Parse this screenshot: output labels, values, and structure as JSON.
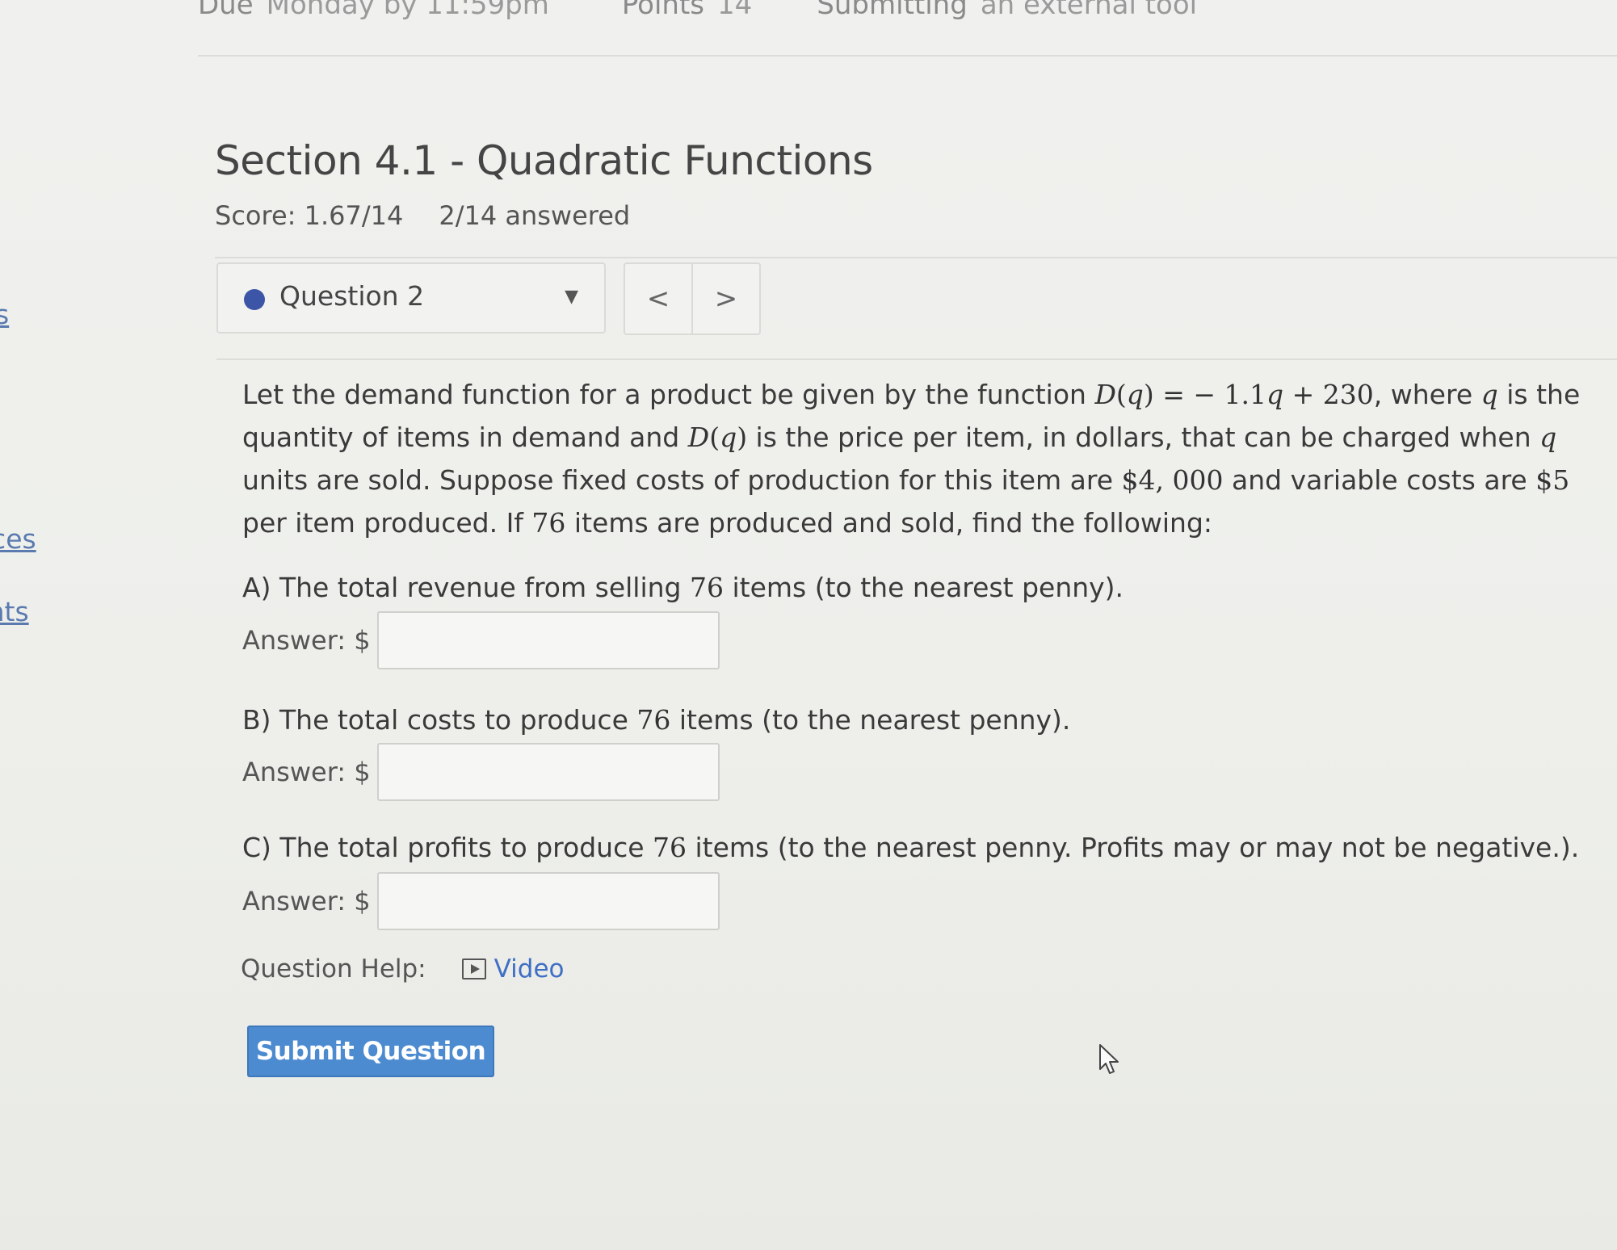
{
  "assignment": {
    "due_label": "Due",
    "due_value": "Monday by 11:59pm",
    "points_label": "Points",
    "points_value": "14",
    "submitting_label": "Submitting",
    "submitting_value": "an external tool"
  },
  "left_nav": {
    "item1": "s",
    "item2": "urces",
    "item3": "ents"
  },
  "section": {
    "title": "Section 4.1 - Quadratic Functions",
    "score": "Score: 1.67/14",
    "answered": "2/14 answered"
  },
  "question_selector": {
    "label": "Question 2",
    "prev": "<",
    "next": ">"
  },
  "question": {
    "intro_1": "Let the demand function for a product be given by the function ",
    "fn_D": "D",
    "fn_q": "q",
    "equation_rhs": " = − 1.1",
    "equation_q2": "q",
    "equation_tail": " + 230",
    "intro_2": ", where ",
    "var_q": "q",
    "intro_3": " is the quantity of items in demand and ",
    "intro_4": " is the price per item, in dollars, that can be charged when ",
    "intro_5": " units are sold. Suppose fixed costs of production for this item are ",
    "fixed_cost": "$4, 000",
    "intro_6": " and variable costs are ",
    "variable_cost": "$5",
    "intro_7": " per item produced. If ",
    "items": "76",
    "intro_8": " items are produced and sold, find the following:"
  },
  "parts": {
    "a_text_1": "A) The total revenue from selling ",
    "a_items": "76",
    "a_text_2": " items (to the nearest penny).",
    "b_text_1": "B) The total costs to produce ",
    "b_items": "76",
    "b_text_2": " items (to the nearest penny).",
    "c_text_1": "C) The total profits to produce ",
    "c_items": "76",
    "c_text_2": " items (to the nearest penny. Profits may or may not be negative.).",
    "answer_label": "Answer: $",
    "a_value": "",
    "b_value": "",
    "c_value": ""
  },
  "help": {
    "label": "Question Help:",
    "video": "Video",
    "icon": "video-play-icon"
  },
  "submit": {
    "label": "Submit Question"
  },
  "colors": {
    "accent": "#4d8bd0",
    "link": "#3f6fc4",
    "status_dot": "#3c55a6"
  }
}
